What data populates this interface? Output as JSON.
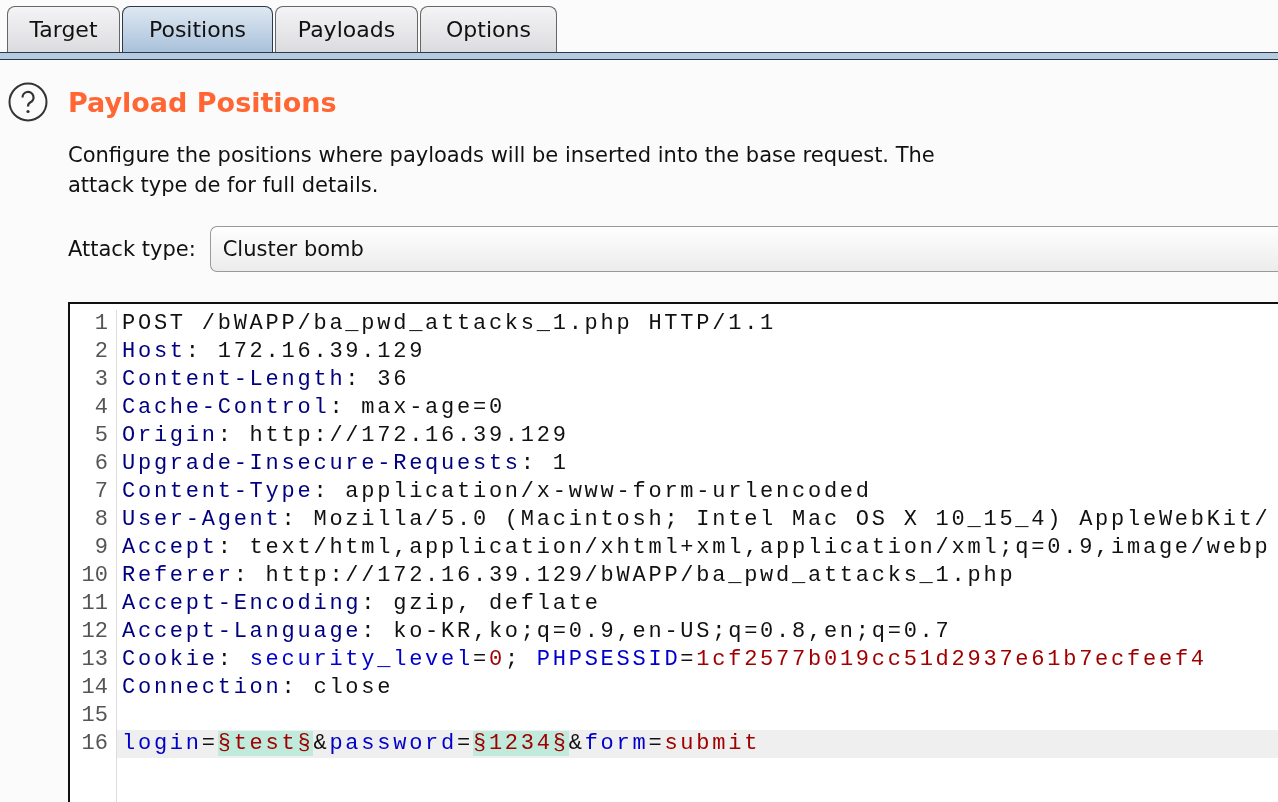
{
  "tabs": [
    {
      "label": "Target",
      "selected": false
    },
    {
      "label": "Positions",
      "selected": true
    },
    {
      "label": "Payloads",
      "selected": false
    },
    {
      "label": "Options",
      "selected": false
    }
  ],
  "section": {
    "title": "Payload Positions",
    "description": "Configure the positions where payloads will be inserted into the base request. The attack type de for full details."
  },
  "attack_type": {
    "label": "Attack type:",
    "value": "Cluster bomb"
  },
  "request_lines": [
    {
      "number": "1",
      "current": false,
      "segments": [
        {
          "kind": "text",
          "text": "POST /bWAPP/ba_pwd_attacks_1.php HTTP/1.1"
        }
      ]
    },
    {
      "number": "2",
      "current": false,
      "segments": [
        {
          "kind": "header",
          "text": "Host"
        },
        {
          "kind": "text",
          "text": ": 172.16.39.129"
        }
      ]
    },
    {
      "number": "3",
      "current": false,
      "segments": [
        {
          "kind": "header",
          "text": "Content-Length"
        },
        {
          "kind": "text",
          "text": ": 36"
        }
      ]
    },
    {
      "number": "4",
      "current": false,
      "segments": [
        {
          "kind": "header",
          "text": "Cache-Control"
        },
        {
          "kind": "text",
          "text": ": max-age=0"
        }
      ]
    },
    {
      "number": "5",
      "current": false,
      "segments": [
        {
          "kind": "header",
          "text": "Origin"
        },
        {
          "kind": "text",
          "text": ": http://172.16.39.129"
        }
      ]
    },
    {
      "number": "6",
      "current": false,
      "segments": [
        {
          "kind": "header",
          "text": "Upgrade-Insecure-Requests"
        },
        {
          "kind": "text",
          "text": ": 1"
        }
      ]
    },
    {
      "number": "7",
      "current": false,
      "segments": [
        {
          "kind": "header",
          "text": "Content-Type"
        },
        {
          "kind": "text",
          "text": ": application/x-www-form-urlencoded"
        }
      ]
    },
    {
      "number": "8",
      "current": false,
      "segments": [
        {
          "kind": "header",
          "text": "User-Agent"
        },
        {
          "kind": "text",
          "text": ": Mozilla/5.0 (Macintosh; Intel Mac OS X 10_15_4) AppleWebKit/"
        }
      ]
    },
    {
      "number": "9",
      "current": false,
      "segments": [
        {
          "kind": "header",
          "text": "Accept"
        },
        {
          "kind": "text",
          "text": ": text/html,application/xhtml+xml,application/xml;q=0.9,image/webp"
        }
      ]
    },
    {
      "number": "10",
      "current": false,
      "segments": [
        {
          "kind": "header",
          "text": "Referer"
        },
        {
          "kind": "text",
          "text": ": http://172.16.39.129/bWAPP/ba_pwd_attacks_1.php"
        }
      ]
    },
    {
      "number": "11",
      "current": false,
      "segments": [
        {
          "kind": "header",
          "text": "Accept-Encoding"
        },
        {
          "kind": "text",
          "text": ": gzip, deflate"
        }
      ]
    },
    {
      "number": "12",
      "current": false,
      "segments": [
        {
          "kind": "header",
          "text": "Accept-Language"
        },
        {
          "kind": "text",
          "text": ": ko-KR,ko;q=0.9,en-US;q=0.8,en;q=0.7"
        }
      ]
    },
    {
      "number": "13",
      "current": false,
      "segments": [
        {
          "kind": "header",
          "text": "Cookie"
        },
        {
          "kind": "text",
          "text": ": "
        },
        {
          "kind": "name",
          "text": "security_level"
        },
        {
          "kind": "text",
          "text": "="
        },
        {
          "kind": "value",
          "text": "0"
        },
        {
          "kind": "text",
          "text": "; "
        },
        {
          "kind": "name",
          "text": "PHPSESSID"
        },
        {
          "kind": "text",
          "text": "="
        },
        {
          "kind": "value",
          "text": "1cf2577b019cc51d2937e61b7ecfeef4"
        }
      ]
    },
    {
      "number": "14",
      "current": false,
      "segments": [
        {
          "kind": "header",
          "text": "Connection"
        },
        {
          "kind": "text",
          "text": ": close"
        }
      ]
    },
    {
      "number": "15",
      "current": false
    },
    {
      "number": "16",
      "current": true,
      "segments": [
        {
          "kind": "name",
          "text": "login"
        },
        {
          "kind": "text",
          "text": "="
        },
        {
          "kind": "payload",
          "text": "§test§"
        },
        {
          "kind": "text",
          "text": "&"
        },
        {
          "kind": "name",
          "text": "password"
        },
        {
          "kind": "text",
          "text": "="
        },
        {
          "kind": "payload",
          "text": "§1234§"
        },
        {
          "kind": "text",
          "text": "&"
        },
        {
          "kind": "name",
          "text": "form"
        },
        {
          "kind": "text",
          "text": "="
        },
        {
          "kind": "value",
          "text": "submit"
        }
      ]
    }
  ]
}
